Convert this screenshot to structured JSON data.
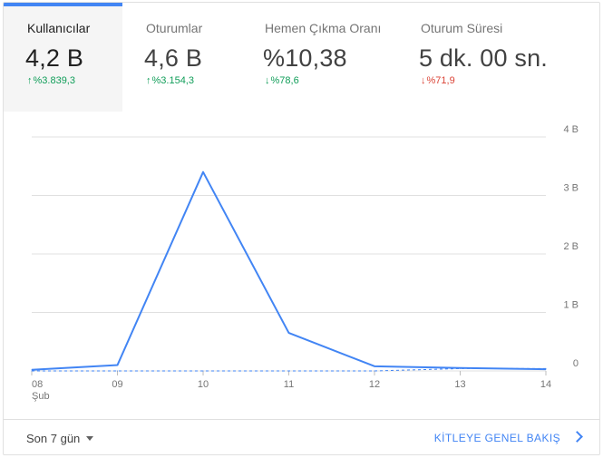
{
  "metrics": [
    {
      "label": "Kullanıcılar",
      "value": "4,2 B",
      "delta_arrow": "↑",
      "delta": "%3.839,3"
    },
    {
      "label": "Oturumlar",
      "value": "4,6 B",
      "delta_arrow": "↑",
      "delta": "%3.154,3"
    },
    {
      "label": "Hemen Çıkma Oranı",
      "value": "%10,38",
      "delta_arrow": "↓",
      "delta": "%78,6"
    },
    {
      "label": "Oturum Süresi",
      "value": "5 dk. 00 sn.",
      "delta_arrow": "↓",
      "delta": "%71,9"
    }
  ],
  "colors": {
    "accent": "#4285f4",
    "positive": "#0f9d58",
    "negative": "#db4437"
  },
  "chart_data": {
    "type": "line",
    "categories": [
      "08",
      "09",
      "10",
      "11",
      "12",
      "13",
      "14"
    ],
    "x_sublabel": "Şub",
    "y_ticks": [
      "0",
      "1 B",
      "2 B",
      "3 B",
      "4 B"
    ],
    "ylim": [
      0,
      4000
    ],
    "grid": true,
    "series": [
      {
        "style": "solid",
        "values": [
          20,
          100,
          3400,
          650,
          80,
          50,
          30
        ]
      },
      {
        "style": "dashed",
        "values": [
          0,
          0,
          0,
          0,
          0,
          40,
          40
        ]
      }
    ]
  },
  "footer": {
    "date_range": "Son 7 gün",
    "report_link": "KİTLEYE GENEL BAKIŞ"
  }
}
